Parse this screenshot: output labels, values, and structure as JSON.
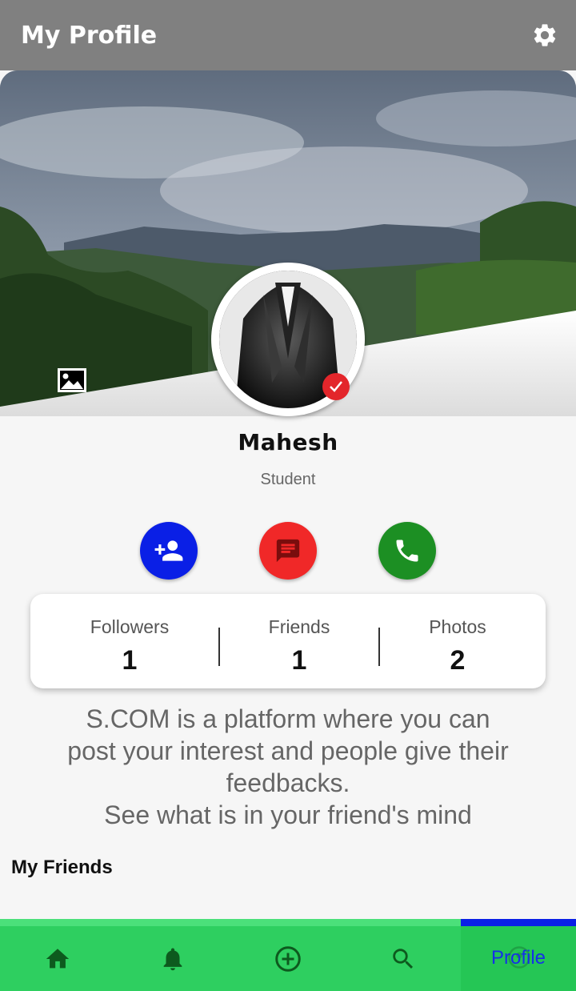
{
  "app_bar": {
    "title": "My Profile",
    "settings_icon": "gear-icon"
  },
  "cover": {
    "gallery_icon": "image-icon"
  },
  "profile": {
    "name": "Mahesh",
    "role": "Student",
    "verified": true
  },
  "actions": [
    {
      "name": "add-friend",
      "icon": "person-add-icon",
      "color": "#0a1fe6"
    },
    {
      "name": "message",
      "icon": "message-icon",
      "color": "#f02828"
    },
    {
      "name": "call",
      "icon": "phone-icon",
      "color": "#1c8f23"
    }
  ],
  "stats": {
    "followers_label": "Followers",
    "followers_value": "1",
    "friends_label": "Friends",
    "friends_value": "1",
    "photos_label": "Photos",
    "photos_value": "2"
  },
  "description": {
    "line1": "S.COM is a platform where you can",
    "line2": "post your interest and people give their",
    "line3": "feedbacks.",
    "line4": "See what is in your friend's mind"
  },
  "friends_section": {
    "heading": "My Friends"
  },
  "bottom_nav": {
    "items": [
      {
        "name": "home",
        "icon": "home-icon"
      },
      {
        "name": "notifications",
        "icon": "bell-icon"
      },
      {
        "name": "add-post",
        "icon": "add-circle-icon"
      },
      {
        "name": "search",
        "icon": "search-icon"
      },
      {
        "name": "profile",
        "icon": "profile-icon",
        "label": "Profile",
        "active": true
      }
    ],
    "colors": {
      "background": "#2ecf60",
      "active_indicator": "#0a1fe6",
      "active_label": "#1530e8"
    }
  }
}
